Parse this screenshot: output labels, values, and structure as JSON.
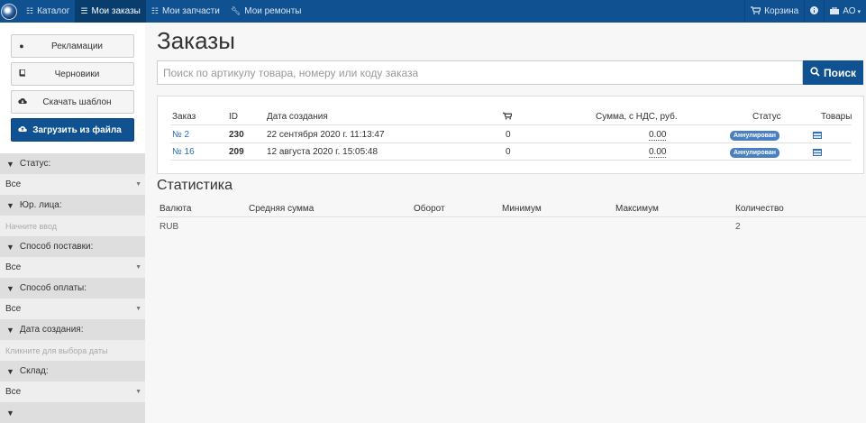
{
  "nav": {
    "items": [
      {
        "label": "Каталог",
        "icon": "sitemap-icon"
      },
      {
        "label": "Мои заказы",
        "icon": "list-icon",
        "active": true
      },
      {
        "label": "Мои запчасти",
        "icon": "sitemap-icon"
      },
      {
        "label": "Мои ремонты",
        "icon": "wrench-icon"
      }
    ],
    "cart_label": "Корзина",
    "user_label": "АО"
  },
  "sidebar": {
    "buttons": [
      {
        "label": "Рекламации",
        "icon": "circle-icon"
      },
      {
        "label": "Черновики",
        "icon": "book-icon"
      },
      {
        "label": "Скачать шаблон",
        "icon": "cloud-download-icon"
      },
      {
        "label": "Загрузить из файла",
        "icon": "cloud-upload-icon",
        "primary": true
      }
    ],
    "filters": [
      {
        "label": "Статус:",
        "value": "Все",
        "type": "select"
      },
      {
        "label": "Юр. лица:",
        "placeholder": "Начните ввод",
        "type": "input"
      },
      {
        "label": "Способ поставки:",
        "value": "Все",
        "type": "select"
      },
      {
        "label": "Способ оплаты:",
        "value": "Все",
        "type": "select"
      },
      {
        "label": "Дата создания:",
        "placeholder": "Кликните для выбора даты",
        "type": "input"
      },
      {
        "label": "Склад:",
        "value": "Все",
        "type": "select"
      }
    ]
  },
  "main": {
    "title": "Заказы",
    "search": {
      "placeholder": "Поиск по артикулу товара, номеру или коду заказа",
      "button_label": "Поиск"
    },
    "orders": {
      "columns": {
        "order": "Заказ",
        "id": "ID",
        "created": "Дата создания",
        "cart": "cart-icon",
        "sum": "Сумма, с НДС, руб.",
        "status": "Статус",
        "goods": "Товары"
      },
      "rows": [
        {
          "order": "№ 2",
          "id": "230",
          "created": "22 сентября 2020 г. 11:13:47",
          "qty": "0",
          "sum": "0.00",
          "status": "Аннулирован"
        },
        {
          "order": "№ 16",
          "id": "209",
          "created": "12 августа 2020 г. 15:05:48",
          "qty": "0",
          "sum": "0.00",
          "status": "Аннулирован"
        }
      ]
    },
    "stats": {
      "title": "Статистика",
      "columns": {
        "currency": "Валюта",
        "avg": "Средняя сумма",
        "turnover": "Оборот",
        "min": "Минимум",
        "max": "Максимум",
        "count": "Количество"
      },
      "rows": [
        {
          "currency": "RUB",
          "avg": "",
          "turnover": "",
          "min": "",
          "max": "",
          "count": "2"
        }
      ]
    }
  },
  "colors": {
    "navbar": "#0f5191",
    "accent": "#0f5191",
    "badge": "#4a7fc1",
    "link": "#2a6cb5"
  }
}
